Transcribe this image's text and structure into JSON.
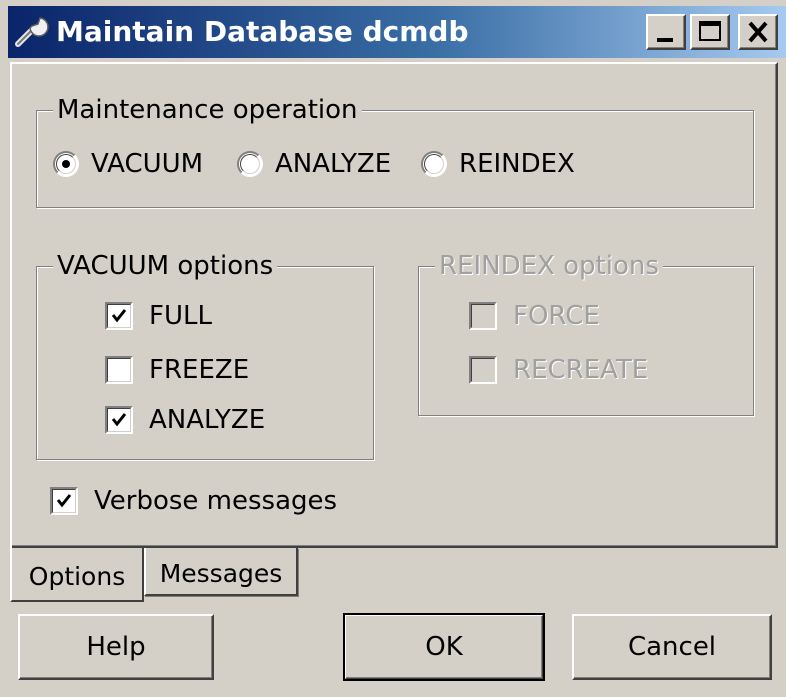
{
  "window": {
    "title": "Maintain Database dcmdb",
    "title_icon": "wrench-icon",
    "controls": {
      "minimize": "minimize-icon",
      "maximize": "maximize-icon",
      "close": "close-icon"
    }
  },
  "maintenance_operation": {
    "label": "Maintenance operation",
    "options": [
      {
        "label": "VACUUM",
        "selected": true
      },
      {
        "label": "ANALYZE",
        "selected": false
      },
      {
        "label": "REINDEX",
        "selected": false
      }
    ]
  },
  "vacuum_options": {
    "label": "VACUUM options",
    "items": [
      {
        "label": "FULL",
        "checked": true
      },
      {
        "label": "FREEZE",
        "checked": false
      },
      {
        "label": "ANALYZE",
        "checked": true
      }
    ]
  },
  "reindex_options": {
    "label": "REINDEX options",
    "enabled": false,
    "items": [
      {
        "label": "FORCE",
        "checked": false
      },
      {
        "label": "RECREATE",
        "checked": false
      }
    ]
  },
  "verbose": {
    "label": "Verbose messages",
    "checked": true
  },
  "tabs": [
    {
      "label": "Options",
      "active": true
    },
    {
      "label": "Messages",
      "active": false
    }
  ],
  "buttons": {
    "help": "Help",
    "ok": "OK",
    "cancel": "Cancel"
  },
  "colors": {
    "face": "#d4d0c8",
    "title_start": "#0a246a",
    "title_end": "#a6caf0",
    "disabled_text": "#a0a0a0"
  }
}
